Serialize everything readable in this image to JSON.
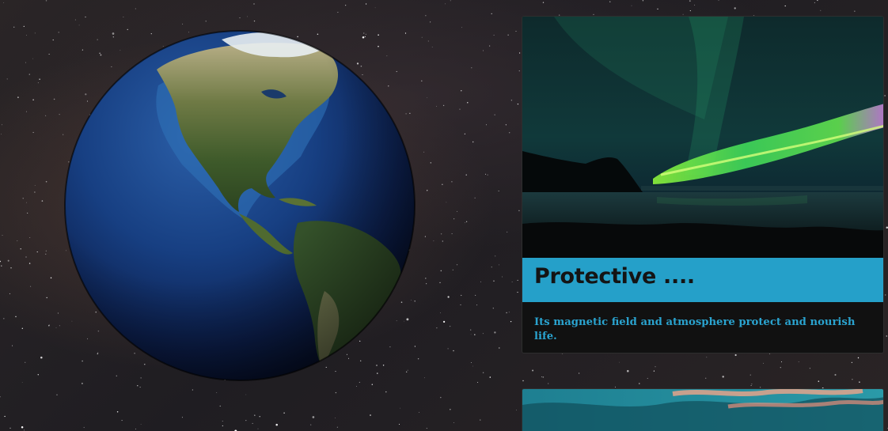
{
  "background": {
    "name": "starry-space-background"
  },
  "globe": {
    "name": "earth-globe",
    "label": "Earth"
  },
  "cards": [
    {
      "image": "aurora-borealis-photo",
      "title": "Protective ....",
      "text": "Its magnetic field and atmosphere protect and nourish life.",
      "accent_color": "#25a0c9"
    },
    {
      "image": "sunset-clouds-photo"
    }
  ]
}
